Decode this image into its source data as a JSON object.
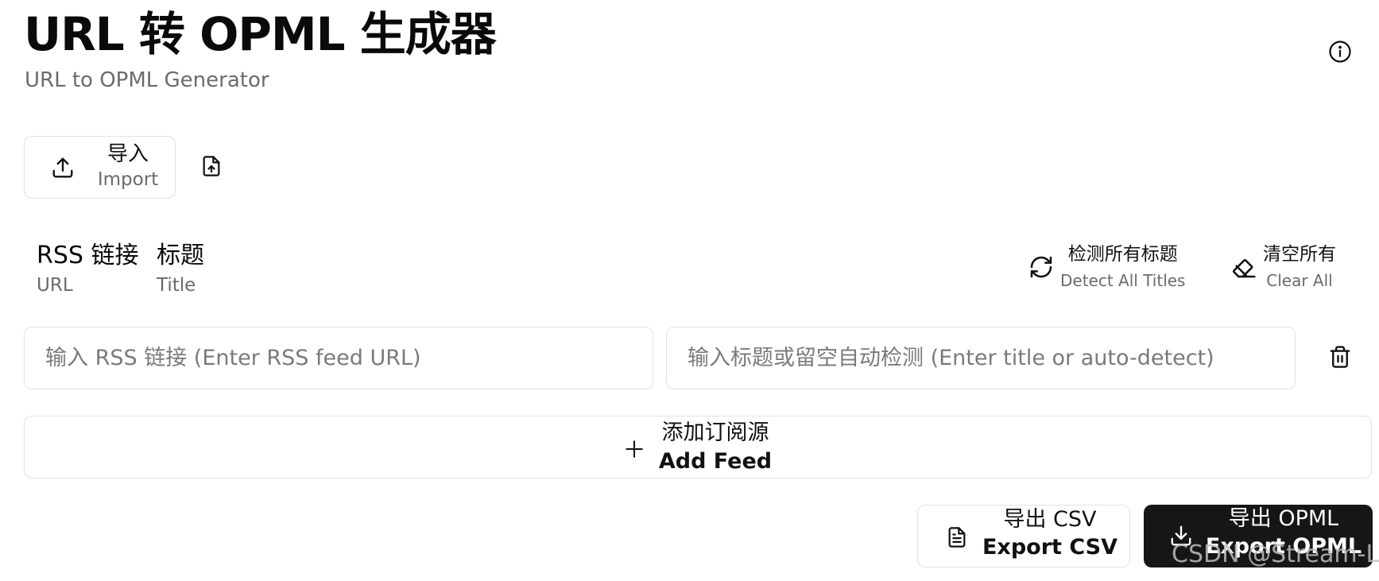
{
  "header": {
    "title": "URL 转 OPML 生成器",
    "subtitle": "URL to OPML Generator",
    "info_icon": "info-icon"
  },
  "import": {
    "label_zh": "导入",
    "label_en": "Import",
    "icon": "upload-icon",
    "file_icon": "file-upload-icon"
  },
  "columns": {
    "url": {
      "zh": "RSS 链接",
      "en": "URL"
    },
    "title": {
      "zh": "标题",
      "en": "Title"
    }
  },
  "actions": {
    "detect": {
      "zh": "检测所有标题",
      "en": "Detect All Titles",
      "icon": "refresh-icon"
    },
    "clear": {
      "zh": "清空所有",
      "en": "Clear All",
      "icon": "eraser-icon"
    }
  },
  "feed_row": {
    "url_value": "",
    "url_placeholder": "输入 RSS 链接 (Enter RSS feed URL)",
    "title_value": "",
    "title_placeholder": "输入标题或留空自动检测 (Enter title or auto-detect)",
    "delete_icon": "trash-icon"
  },
  "add_feed": {
    "zh": "添加订阅源",
    "en": "Add Feed",
    "icon": "plus-icon"
  },
  "export": {
    "csv": {
      "zh": "导出 CSV",
      "en": "Export CSV",
      "icon": "file-text-icon"
    },
    "opml": {
      "zh": "导出 OPML",
      "en": "Export OPML",
      "icon": "download-icon"
    }
  },
  "watermark": "CSDN @Stream-L",
  "colors": {
    "text": "#0a0a0a",
    "muted": "#6b6b6b",
    "border": "#e2e2e2",
    "primary_button": "#161616"
  }
}
